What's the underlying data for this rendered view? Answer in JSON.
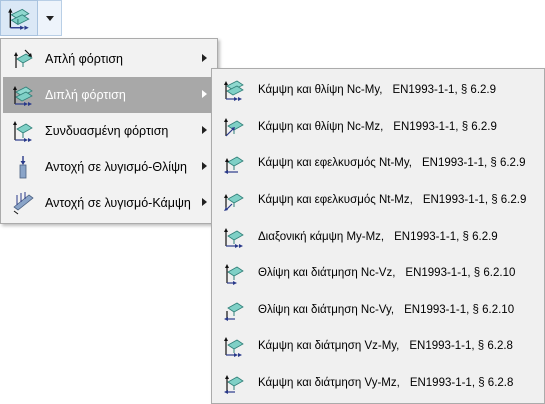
{
  "menu": {
    "items": [
      {
        "label": "Απλή φόρτιση",
        "icon": "simple-load-icon"
      },
      {
        "label": "Διπλή φόρτιση",
        "icon": "double-load-icon"
      },
      {
        "label": "Συνδυασμένη φόρτιση",
        "icon": "combined-load-icon"
      },
      {
        "label": "Αντοχή σε λυγισμό-Θλίψη",
        "icon": "buckling-compression-icon"
      },
      {
        "label": "Αντοχή σε λυγισμό-Κάμψη",
        "icon": "buckling-bending-icon"
      }
    ],
    "highlighted_index": 1
  },
  "submenu": {
    "items": [
      {
        "label": "Κάμψη και θλίψη Nc-My,",
        "std": "EN1993-1-1, § 6.2.9"
      },
      {
        "label": "Κάμψη και θλίψη Nc-Mz,",
        "std": "EN1993-1-1, § 6.2.9"
      },
      {
        "label": "Κάμψη και εφελκυσμός Nt-My,",
        "std": "EN1993-1-1, § 6.2.9"
      },
      {
        "label": "Κάμψη και εφελκυσμός Nt-Mz,",
        "std": "EN1993-1-1, § 6.2.9"
      },
      {
        "label": "Διαξονική κάμψη My-Mz,",
        "std": "EN1993-1-1, § 6.2.9"
      },
      {
        "label": "Θλίψη  και διάτμηση Nc-Vz,",
        "std": "EN1993-1-1, § 6.2.10"
      },
      {
        "label": "Θλίψη  και διάτμηση Nc-Vy,",
        "std": "EN1993-1-1, § 6.2.10"
      },
      {
        "label": "Κάμψη και διάτμηση Vz-My,",
        "std": "EN1993-1-1, § 6.2.8"
      },
      {
        "label": "Κάμψη και διάτμηση Vy-Mz,",
        "std": "EN1993-1-1, § 6.2.8"
      }
    ]
  },
  "colors": {
    "highlight": "#a8a8a8",
    "plate": "#7fd0c6",
    "arrow": "#2a3a8a"
  }
}
